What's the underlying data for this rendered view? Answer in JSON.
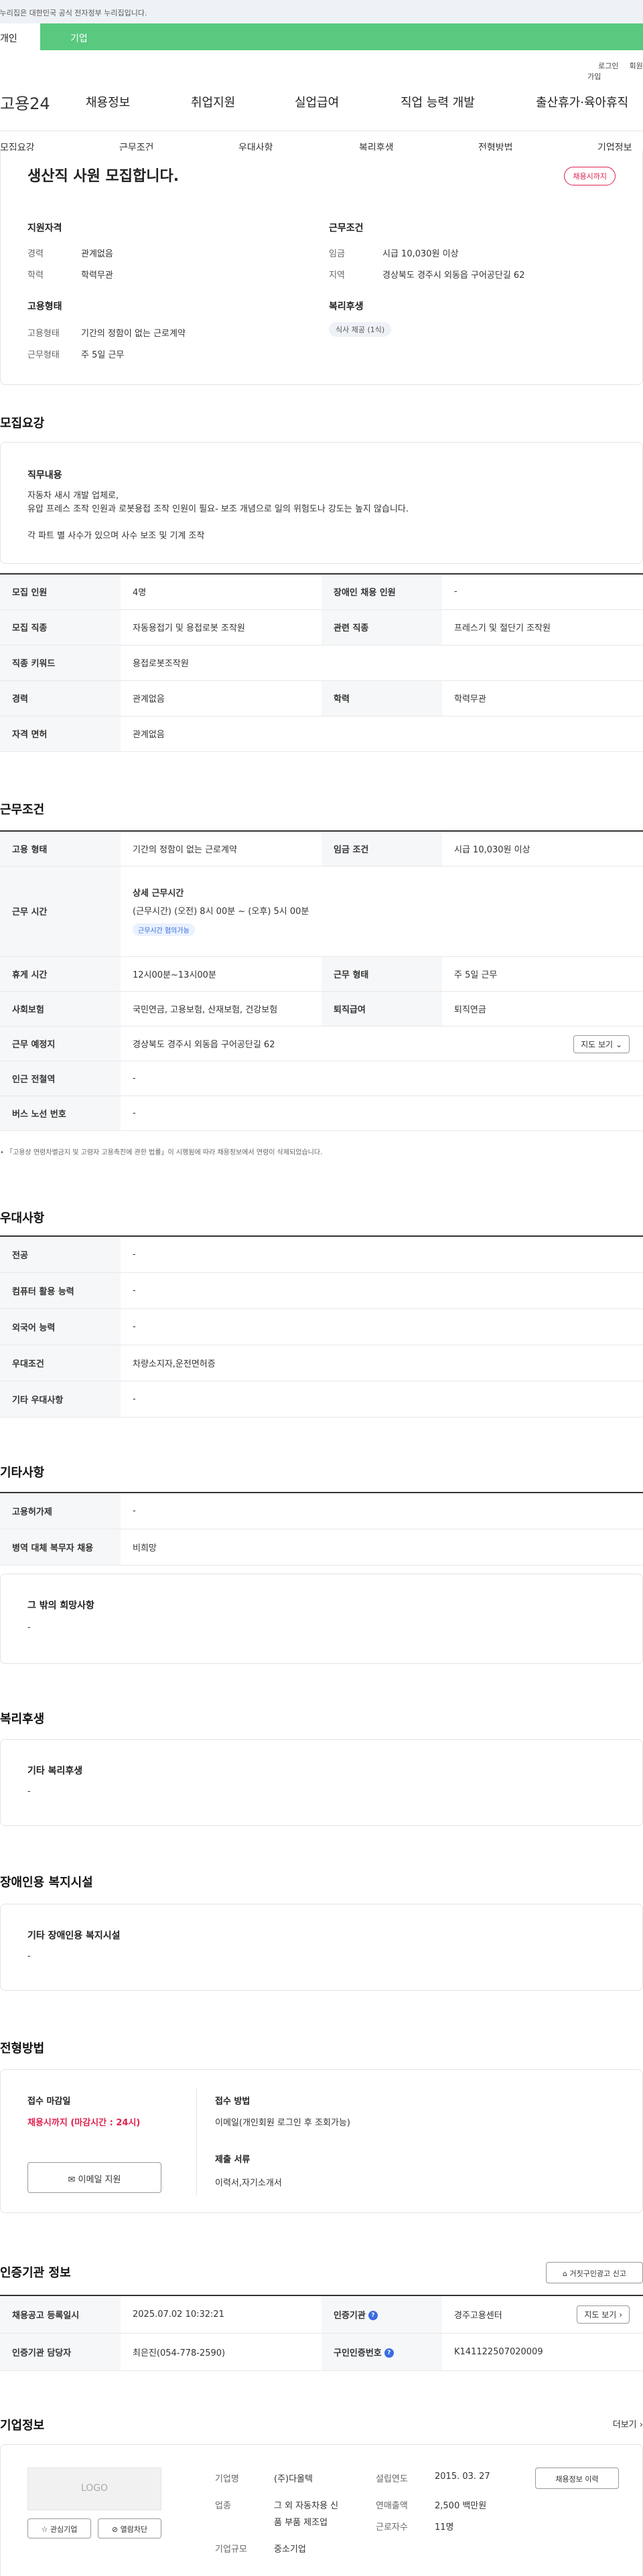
{
  "notice": "이 누리집은 대한민국 공식 전자정부 누리집입니다.",
  "user_tabs": [
    "개인",
    "기업"
  ],
  "top_links": [
    "로그인",
    "회원가입"
  ],
  "logo": "고용24",
  "gnb": [
    "채용정보",
    "취업지원",
    "실업급여",
    "직업 능력 개발",
    "출산휴가·육아휴직"
  ],
  "lnb": [
    "모집요강",
    "근무조건",
    "우대사항",
    "복리후생",
    "전형방법",
    "기업정보"
  ],
  "summary": {
    "title": "생산직 사원 모집합니다.",
    "badge": "채용시까지",
    "qual_title": "지원자격",
    "career_lbl": "경력",
    "career_val": "관계없음",
    "edu_lbl": "학력",
    "edu_val": "학력무관",
    "cond_title": "근무조건",
    "wage_lbl": "임금",
    "wage_val": "시급 10,030원 이상",
    "area_lbl": "지역",
    "area_val": "경상북도 경주시 외동읍 구어공단길 62",
    "emp_title": "고용형태",
    "etype_lbl": "고용형태",
    "etype_val": "기간의 정함이 없는 근로계약",
    "hours_lbl": "근무형태",
    "hours_val": "주 5일 근무",
    "welfare_title": "복리후생",
    "welfare_chip": "식사 제공 (1식)"
  },
  "recruit": {
    "heading": "모집요강",
    "duty_title": "직무내용",
    "duty_line1": "자동차 새시 개발 업체로,",
    "duty_line2": "유압 프레스 조작 인원과 로봇용접 조작 인원이 필요- 보조 개념으로 일의 위험도나 강도는 높지 않습니다.",
    "duty_line3": "각 파트 별 사수가 있으며 사수 보조 및 기계 조작",
    "rows": [
      [
        "모집 인원",
        "4명",
        "장애인 채용 인원",
        "-"
      ],
      [
        "모집 직종",
        "자동용접기 및 용접로봇 조작원",
        "관련 직종",
        "프레스기 및 절단기 조작원"
      ],
      [
        "직종 키워드",
        "용접로봇조작원"
      ],
      [
        "경력",
        "관계없음",
        "학력",
        "학력무관"
      ],
      [
        "자격 면허",
        "관계없음"
      ]
    ]
  },
  "work": {
    "heading": "근무조건",
    "etype_th": "고용 형태",
    "etype_td": "기간의 정함이 없는 근로계약",
    "wage_th": "임금 조건",
    "wage_td": "시급 10,030원 이상",
    "time_th": "근무 시간",
    "time_sub": "상세 근무시간",
    "time_detail": "(근무시간) (오전) 8시 00분 ~ (오후) 5시 00분",
    "time_chip": "근무시간 협의가능",
    "break_th": "휴게 시간",
    "break_td": "12시00분~13시00분",
    "form_th": "근무 형태",
    "form_td": "주 5일 근무",
    "ins_th": "사회보험",
    "ins_td": "국민연금, 고용보험, 산재보험, 건강보험",
    "ret_th": "퇴직급여",
    "ret_td": "퇴직연금",
    "place_th": "근무 예정지",
    "place_td": "경상북도 경주시 외동읍 구어공단길 62",
    "map_btn": "지도 보기",
    "subway_th": "인근 전철역",
    "subway_td": "-",
    "bus_th": "버스 노선 번호",
    "bus_td": "-",
    "note": "「고용상 연령차별금지 및 고령자 고용촉진에 관한 법률」이 시행됨에 따라 채용정보에서 연령이 삭제되었습니다."
  },
  "prefer": {
    "heading": "우대사항",
    "rows": [
      [
        "전공",
        "-"
      ],
      [
        "컴퓨터 활용 능력",
        "-"
      ],
      [
        "외국어 능력",
        "-"
      ],
      [
        "우대조건",
        "차량소지자,운전면허증"
      ],
      [
        "기타 우대사항",
        "-"
      ]
    ]
  },
  "etc": {
    "heading": "기타사항",
    "rows": [
      [
        "고용허가제",
        "-"
      ],
      [
        "병역 대체 복무자 채용",
        "비희망"
      ]
    ],
    "hope_title": "그 밖의 희망사항",
    "hope_val": "-"
  },
  "welfare": {
    "heading": "복리후생",
    "title": "기타 복리후생",
    "val": "-"
  },
  "facility": {
    "heading": "장애인용 복지시설",
    "title": "기타 장애인용 복지시설",
    "val": "-"
  },
  "process": {
    "heading": "전형방법",
    "deadline_title": "접수 마감일",
    "deadline_val": "채용시까지 (마감시간 : 24시)",
    "email_btn": "이메일 지원",
    "method_title": "접수 방법",
    "method_val": "이메일(개인회원 로그인 후 조회가능)",
    "docs_title": "제출 서류",
    "docs_val": "이력서,자기소개서"
  },
  "agency": {
    "heading": "인증기관 정보",
    "report_btn": "거짓구인광고 신고",
    "reg_th": "채용공고 등록일시",
    "reg_td": "2025.07.02 10:32:21",
    "org_th": "인증기관",
    "org_td": "경주고용센터",
    "map_btn": "지도 보기",
    "mgr_th": "인증기관 담당자",
    "mgr_td": "최은진(054-778-2590)",
    "num_th": "구인인증번호",
    "num_td": "K141122507020009"
  },
  "company": {
    "heading": "기업정보",
    "more": "더보기",
    "logo": "LOGO",
    "fav_btn": "관심기업",
    "block_btn": "열람차단",
    "name_lbl": "기업명",
    "name_val": "(주)다올텍",
    "ind_lbl": "업종",
    "ind_val1": "그 외 자동차용 신",
    "ind_val2": "품 부품 제조업",
    "size_lbl": "기업규모",
    "size_val": "중소기업",
    "est_lbl": "설립연도",
    "est_val": "2015. 03. 27",
    "sales_lbl": "연매출액",
    "sales_val": "2,500 백만원",
    "emp_lbl": "근로자수",
    "emp_val": "11명",
    "hist_btn": "채용정보 이력"
  }
}
